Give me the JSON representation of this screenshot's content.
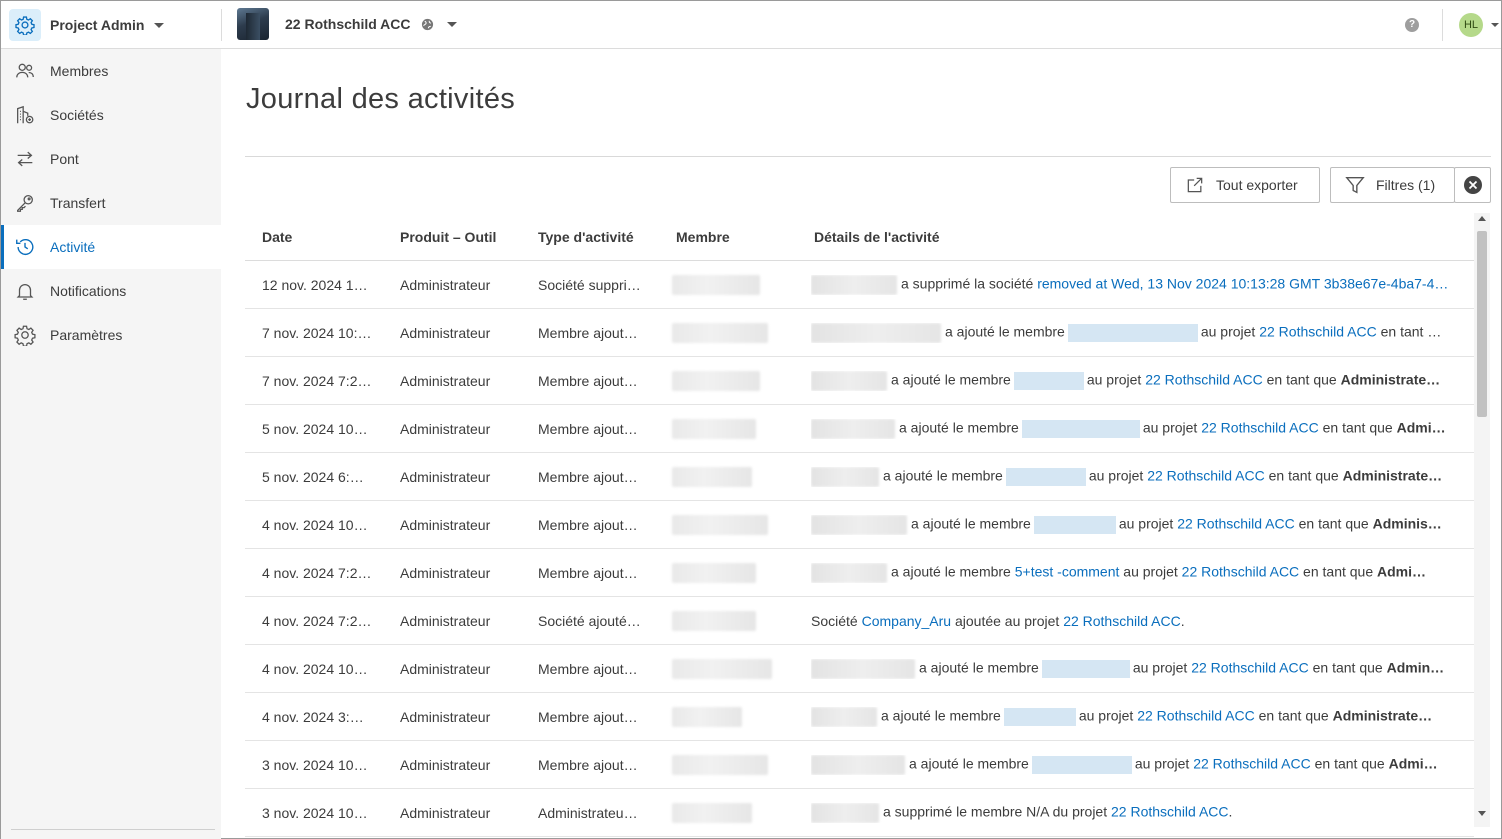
{
  "app": {
    "title": "Project Admin"
  },
  "project": {
    "name": "22 Rothschild ACC"
  },
  "user": {
    "initials": "HL"
  },
  "colors": {
    "accent": "#0a6ebd",
    "avatar": "#b5d98a",
    "app_logo_bg": "#dbeefa"
  },
  "sidebar": {
    "items": [
      {
        "label": "Membres",
        "icon": "people-icon"
      },
      {
        "label": "Sociétés",
        "icon": "company-icon"
      },
      {
        "label": "Pont",
        "icon": "bridge-arrows-icon"
      },
      {
        "label": "Transfert",
        "icon": "key-icon"
      },
      {
        "label": "Activité",
        "icon": "history-icon",
        "active": true
      },
      {
        "label": "Notifications",
        "icon": "bell-icon"
      },
      {
        "label": "Paramètres",
        "icon": "gear-icon"
      }
    ]
  },
  "page": {
    "title": "Journal des activités"
  },
  "toolbar": {
    "export_label": "Tout exporter",
    "filter_label": "Filtres (1)"
  },
  "table": {
    "headers": {
      "date": "Date",
      "product": "Produit – Outil",
      "type": "Type d'activité",
      "member": "Membre",
      "details": "Détails de l'activité"
    },
    "rows": [
      {
        "date": "12 nov. 2024 1…",
        "product": "Administrateur",
        "type": "Société suppri…",
        "details": [
          {
            "t": "a supprimé la société "
          },
          {
            "t": "removed at Wed, 13 Nov 2024 10:13:28 GMT 3b38e67e-4ba7-4…",
            "link": true
          }
        ]
      },
      {
        "date": "7 nov. 2024 10:…",
        "product": "Administrateur",
        "type": "Membre ajout…",
        "details": [
          {
            "t": "a ajouté le membre"
          },
          {
            "redact": true
          },
          {
            "t": "au projet "
          },
          {
            "t": "22 Rothschild ACC",
            "link": true
          },
          {
            "t": " en tant …"
          }
        ]
      },
      {
        "date": "7 nov. 2024 7:2…",
        "product": "Administrateur",
        "type": "Membre ajout…",
        "details": [
          {
            "t": "a ajouté le membre"
          },
          {
            "redact": true
          },
          {
            "t": "au projet "
          },
          {
            "t": "22 Rothschild ACC",
            "link": true
          },
          {
            "t": " en tant que "
          },
          {
            "t": "Administrate…",
            "bold": true
          }
        ]
      },
      {
        "date": "5 nov. 2024 10…",
        "product": "Administrateur",
        "type": "Membre ajout…",
        "details": [
          {
            "t": "a ajouté le membre"
          },
          {
            "redact": true
          },
          {
            "t": "au projet "
          },
          {
            "t": "22 Rothschild ACC",
            "link": true
          },
          {
            "t": " en tant que "
          },
          {
            "t": "Admi…",
            "bold": true
          }
        ]
      },
      {
        "date": "5 nov. 2024 6:…",
        "product": "Administrateur",
        "type": "Membre ajout…",
        "details": [
          {
            "t": "a ajouté le membre"
          },
          {
            "redact": true
          },
          {
            "t": "au projet "
          },
          {
            "t": "22 Rothschild ACC",
            "link": true
          },
          {
            "t": " en tant que "
          },
          {
            "t": "Administrate…",
            "bold": true
          }
        ]
      },
      {
        "date": "4 nov. 2024 10…",
        "product": "Administrateur",
        "type": "Membre ajout…",
        "details": [
          {
            "t": "a ajouté le membre"
          },
          {
            "redact": true
          },
          {
            "t": "au projet "
          },
          {
            "t": "22 Rothschild ACC",
            "link": true
          },
          {
            "t": " en tant que "
          },
          {
            "t": "Adminis…",
            "bold": true
          }
        ]
      },
      {
        "date": "4 nov. 2024 7:2…",
        "product": "Administrateur",
        "type": "Membre ajout…",
        "details": [
          {
            "t": "a ajouté le membre "
          },
          {
            "t": "5+test -comment",
            "link": true
          },
          {
            "t": " au projet "
          },
          {
            "t": "22 Rothschild ACC",
            "link": true
          },
          {
            "t": " en tant que "
          },
          {
            "t": "Admi…",
            "bold": true
          }
        ]
      },
      {
        "date": "4 nov. 2024 7:2…",
        "product": "Administrateur",
        "type": "Société ajouté…",
        "no_actor": true,
        "details": [
          {
            "t": "Société "
          },
          {
            "t": "Company_Aru",
            "link": true
          },
          {
            "t": " ajoutée au projet "
          },
          {
            "t": "22 Rothschild ACC",
            "link": true
          },
          {
            "t": "."
          }
        ]
      },
      {
        "date": "4 nov. 2024 10…",
        "product": "Administrateur",
        "type": "Membre ajout…",
        "details": [
          {
            "t": "a ajouté le membre"
          },
          {
            "redact": true
          },
          {
            "t": "au projet "
          },
          {
            "t": "22 Rothschild ACC",
            "link": true
          },
          {
            "t": " en tant que "
          },
          {
            "t": "Admin…",
            "bold": true
          }
        ]
      },
      {
        "date": "4 nov. 2024 3:…",
        "product": "Administrateur",
        "type": "Membre ajout…",
        "details": [
          {
            "t": "a ajouté le membre"
          },
          {
            "redact": true
          },
          {
            "t": "au projet "
          },
          {
            "t": "22 Rothschild ACC",
            "link": true
          },
          {
            "t": " en tant que "
          },
          {
            "t": "Administrate…",
            "bold": true
          }
        ]
      },
      {
        "date": "3 nov. 2024 10…",
        "product": "Administrateur",
        "type": "Membre ajout…",
        "details": [
          {
            "t": "a ajouté le membre"
          },
          {
            "redact": true
          },
          {
            "t": "au projet "
          },
          {
            "t": "22 Rothschild ACC",
            "link": true
          },
          {
            "t": " en tant que "
          },
          {
            "t": "Admi…",
            "bold": true
          }
        ]
      },
      {
        "date": "3 nov. 2024 10…",
        "product": "Administrateur",
        "type": "Administrateu…",
        "details": [
          {
            "t": "a supprimé le membre N/A du projet "
          },
          {
            "t": "22 Rothschild ACC",
            "link": true
          },
          {
            "t": "."
          }
        ]
      }
    ]
  }
}
